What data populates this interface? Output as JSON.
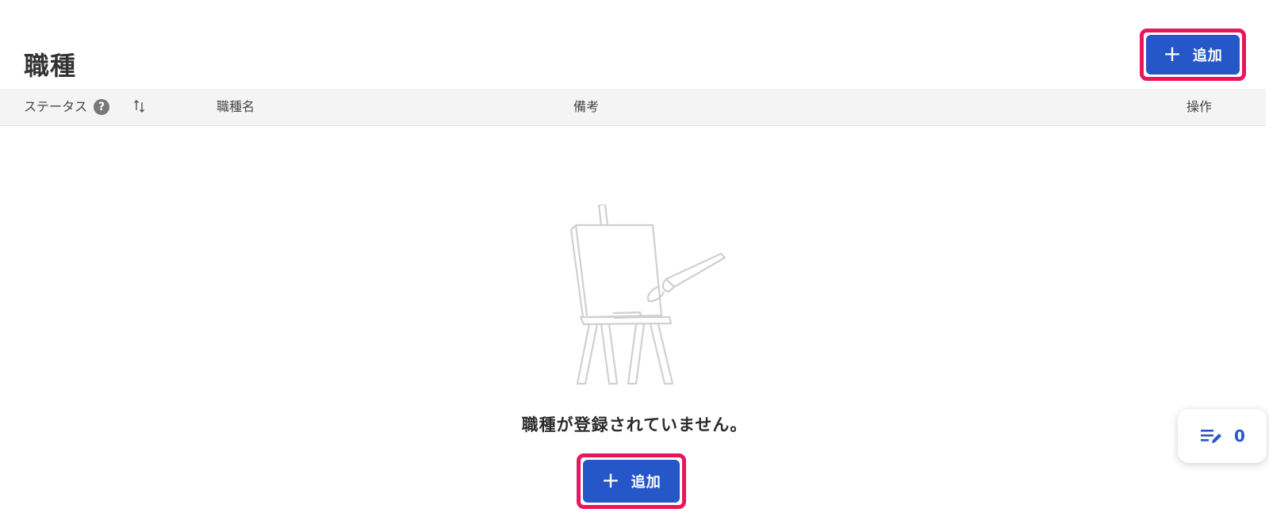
{
  "page": {
    "title": "職種"
  },
  "actions": {
    "add_label": "追加",
    "plus_symbol": "+"
  },
  "table": {
    "columns": {
      "status": "ステータス",
      "name": "職種名",
      "note": "備考",
      "operations": "操作"
    },
    "help_symbol": "?",
    "sort_icon": "sort-arrows-icon"
  },
  "empty_state": {
    "illustration": "easel-canvas-icon",
    "message": "職種が登録されていません。"
  },
  "floating_widget": {
    "icon": "list-edit-icon",
    "count": "0"
  },
  "colors": {
    "primary": "#2557c9",
    "highlight": "#e8175d",
    "header_bg": "#f5f4f4"
  }
}
